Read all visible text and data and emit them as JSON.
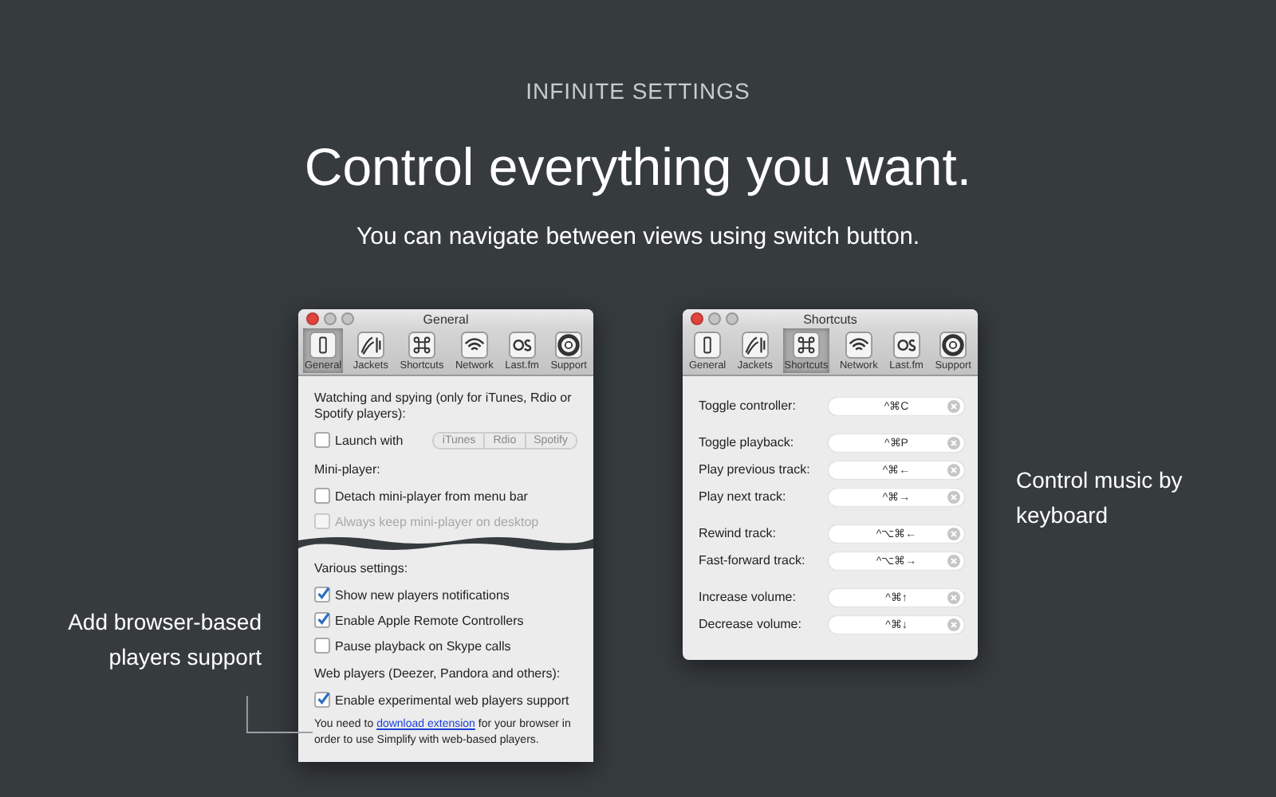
{
  "header": {
    "eyebrow": "INFINITE SETTINGS",
    "title": "Control everything you want.",
    "subtitle": "You can navigate between views using switch button."
  },
  "left_caption": "Add browser-based players support",
  "general_window": {
    "title": "General",
    "toolbar": [
      {
        "label": "General",
        "selected": true
      },
      {
        "label": "Jackets",
        "selected": false
      },
      {
        "label": "Shortcuts",
        "selected": false
      },
      {
        "label": "Network",
        "selected": false
      },
      {
        "label": "Last.fm",
        "selected": false
      },
      {
        "label": "Support",
        "selected": false
      }
    ],
    "items": [
      {
        "kind": "heading",
        "text": "Watching and spying (only for iTunes, Rdio or Spotify players):"
      },
      {
        "kind": "launch",
        "label": "Launch with",
        "checked": false,
        "options": [
          {
            "label": "iTunes",
            "selected": false
          },
          {
            "label": "Rdio",
            "selected": false
          },
          {
            "label": "Spotify",
            "selected": false
          }
        ]
      },
      {
        "kind": "heading",
        "text": "Mini-player:"
      },
      {
        "kind": "checkbox",
        "label": "Detach mini-player from menu bar",
        "checked": false,
        "disabled": false
      },
      {
        "kind": "checkbox",
        "label": "Always keep mini-player on desktop",
        "checked": false,
        "disabled": true
      },
      {
        "kind": "tear"
      },
      {
        "kind": "heading",
        "text": "Various settings:"
      },
      {
        "kind": "checkbox",
        "label": "Show new players notifications",
        "checked": true,
        "disabled": false
      },
      {
        "kind": "checkbox",
        "label": "Enable Apple Remote Controllers",
        "checked": true,
        "disabled": false
      },
      {
        "kind": "checkbox",
        "label": "Pause playback on Skype calls",
        "checked": false,
        "disabled": false
      },
      {
        "kind": "heading",
        "text": "Web players (Deezer, Pandora and others):"
      },
      {
        "kind": "checkbox",
        "label": "Enable experimental web players support",
        "checked": true,
        "disabled": false
      },
      {
        "kind": "note",
        "before": "You need to ",
        "link": "download extension",
        "after": " for your browser in order to use Simplify with web-based players."
      }
    ]
  },
  "shortcuts_window": {
    "title": "Shortcuts",
    "toolbar": [
      {
        "label": "General",
        "selected": false
      },
      {
        "label": "Jackets",
        "selected": false
      },
      {
        "label": "Shortcuts",
        "selected": true
      },
      {
        "label": "Network",
        "selected": false
      },
      {
        "label": "Last.fm",
        "selected": false
      },
      {
        "label": "Support",
        "selected": false
      }
    ],
    "groups": [
      [
        {
          "label": "Toggle controller:",
          "keys": "^⌘C"
        }
      ],
      [
        {
          "label": "Toggle playback:",
          "keys": "^⌘P"
        },
        {
          "label": "Play previous track:",
          "keys": "^⌘←"
        },
        {
          "label": "Play next track:",
          "keys": "^⌘→"
        }
      ],
      [
        {
          "label": "Rewind track:",
          "keys": "^⌥⌘←"
        },
        {
          "label": "Fast-forward track:",
          "keys": "^⌥⌘→"
        }
      ],
      [
        {
          "label": "Increase volume:",
          "keys": "^⌘↑"
        },
        {
          "label": "Decrease volume:",
          "keys": "^⌘↓"
        }
      ]
    ]
  },
  "right_caption": "Control music by keyboard"
}
